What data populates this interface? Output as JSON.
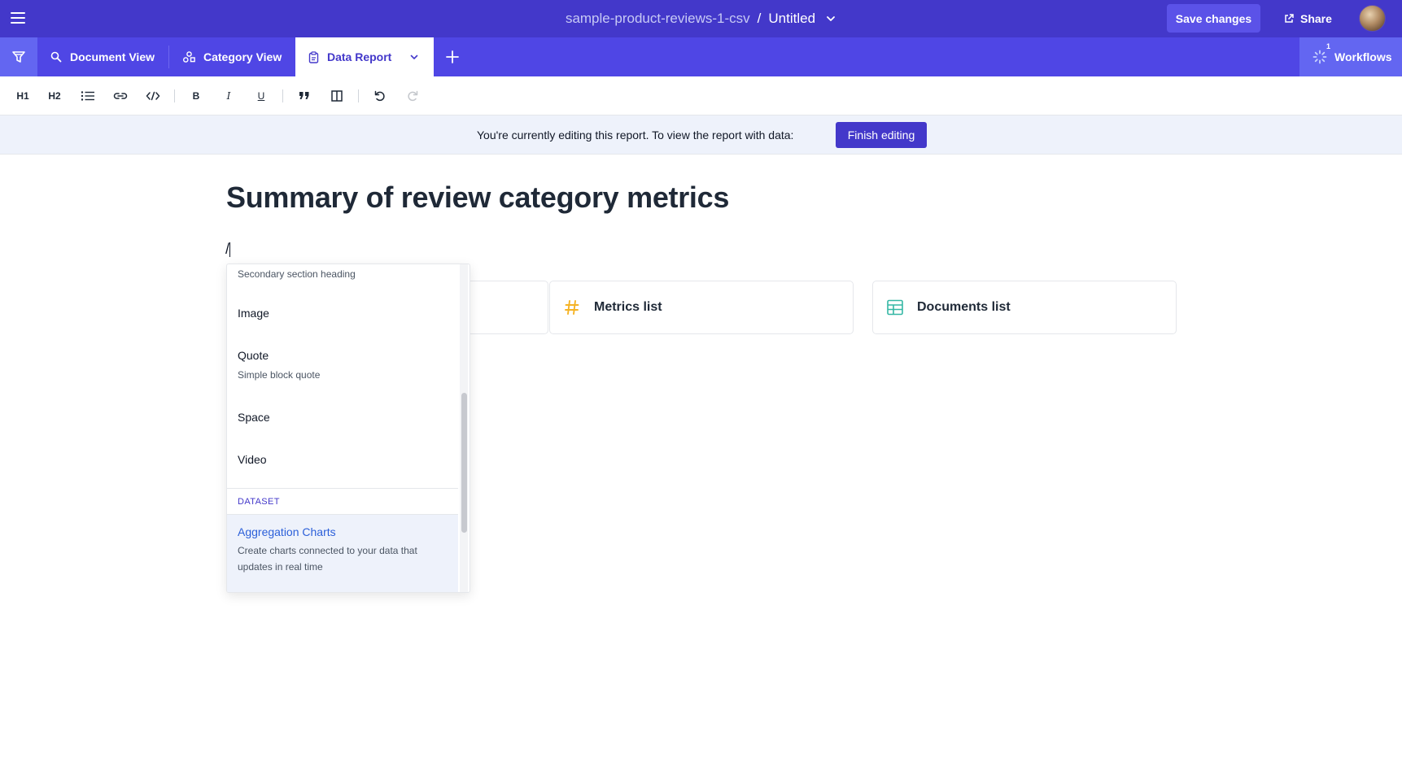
{
  "header": {
    "dataset_name": "sample-product-reviews-1-csv",
    "separator": "/",
    "document_title": "Untitled",
    "save_label": "Save changes",
    "share_label": "Share"
  },
  "tabs": {
    "items": [
      {
        "label": "Document View",
        "icon": "search-docs-icon"
      },
      {
        "label": "Category View",
        "icon": "shapes-icon"
      },
      {
        "label": "Data Report",
        "icon": "clipboard-icon",
        "active": true
      }
    ],
    "workflows_label": "Workflows",
    "workflows_badge": "1"
  },
  "toolbar": {
    "h1": "H1",
    "h2": "H2",
    "bold": "B",
    "italic": "I",
    "underline": "U"
  },
  "banner": {
    "text": "You're currently editing this report. To view the report with data:",
    "button_label": "Finish editing"
  },
  "document": {
    "title": "Summary of review category metrics",
    "slash_text": "/"
  },
  "cards": {
    "metrics": "Metrics list",
    "documents": "Documents list"
  },
  "menu": {
    "items": [
      {
        "desc": "Secondary section heading"
      },
      {
        "label": "Image"
      },
      {
        "label": "Quote",
        "desc": "Simple block quote"
      },
      {
        "label": "Space"
      },
      {
        "label": "Video"
      }
    ],
    "section_label": "DATASET",
    "highlighted": {
      "label": "Aggregation Charts",
      "desc_line1": "Create charts connected to your data that",
      "desc_line2": "updates in real time"
    }
  },
  "colors": {
    "topbar": "#4338ca",
    "tabbar": "#4f46e5",
    "accent": "#5b52e8",
    "metrics_icon": "#f5b324",
    "documents_icon": "#35b7a5"
  }
}
